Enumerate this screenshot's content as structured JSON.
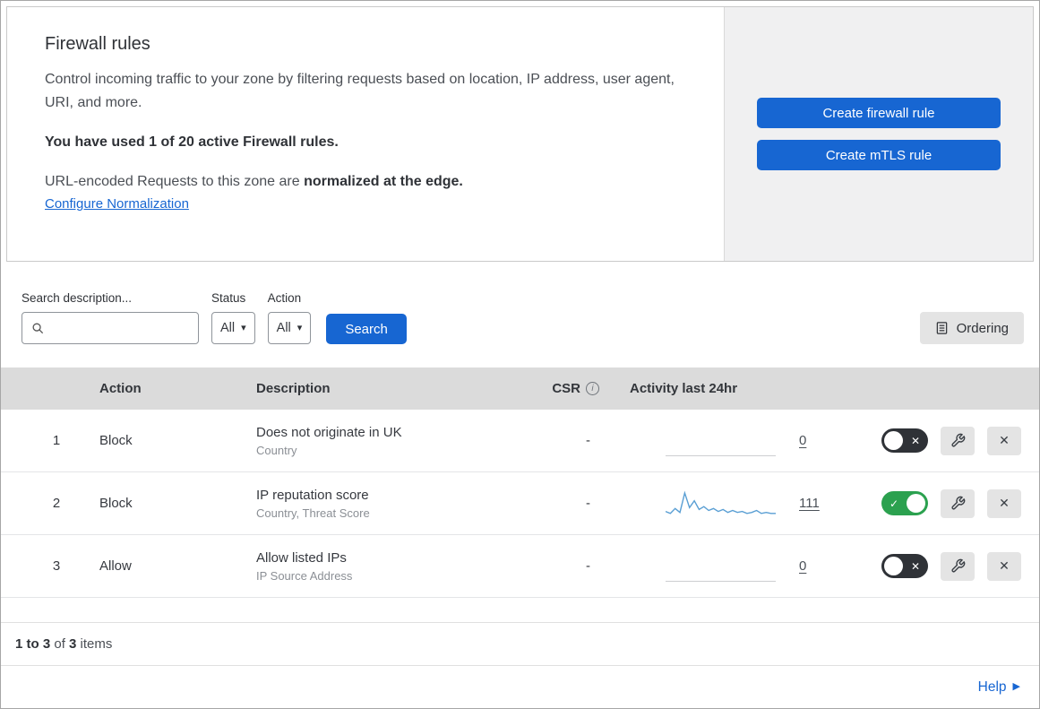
{
  "colors": {
    "accent": "#1766d2",
    "toggle_on": "#2ba14f",
    "toggle_off": "#2f3237",
    "sparkline": "#5a9fd4"
  },
  "icons": {
    "caret_down": "▾",
    "close": "✕",
    "check": "✓",
    "help_arrow": "▶",
    "info": "i"
  },
  "intro": {
    "title": "Firewall rules",
    "description": "Control incoming traffic to your zone by filtering requests based on location, IP address, user agent, URI, and more.",
    "usage": "You have used 1 of 20 active Firewall rules.",
    "normalization_prefix": "URL-encoded Requests to this zone are ",
    "normalization_bold": "normalized at the edge.",
    "normalization_link": "Configure Normalization",
    "create_firewall_button": "Create firewall rule",
    "create_mtls_button": "Create mTLS rule"
  },
  "filters": {
    "search_label": "Search description...",
    "search_value": "",
    "status_label": "Status",
    "status_value": "All",
    "action_label": "Action",
    "action_value": "All",
    "search_button": "Search",
    "ordering_button": "Ordering"
  },
  "table": {
    "headers": {
      "action": "Action",
      "description": "Description",
      "csr": "CSR",
      "activity": "Activity last 24hr"
    },
    "rows": [
      {
        "index": "1",
        "action": "Block",
        "description": "Does not originate in UK",
        "fields": "Country",
        "csr": "-",
        "activity_count": "0",
        "enabled": false,
        "sparkline": null
      },
      {
        "index": "2",
        "action": "Block",
        "description": "IP reputation score",
        "fields": "Country, Threat Score",
        "csr": "-",
        "activity_count": "111",
        "enabled": true,
        "sparkline": [
          5,
          3,
          8,
          4,
          24,
          9,
          16,
          7,
          10,
          6,
          8,
          5,
          7,
          4,
          6,
          4,
          5,
          3,
          4,
          6,
          3,
          4,
          3,
          3
        ]
      },
      {
        "index": "3",
        "action": "Allow",
        "description": "Allow listed IPs",
        "fields": "IP Source Address",
        "csr": "-",
        "activity_count": "0",
        "enabled": false,
        "sparkline": null
      }
    ]
  },
  "footer": {
    "range": "1 to 3",
    "of_word": " of ",
    "total": "3",
    "items_word": " items",
    "help": "Help"
  }
}
